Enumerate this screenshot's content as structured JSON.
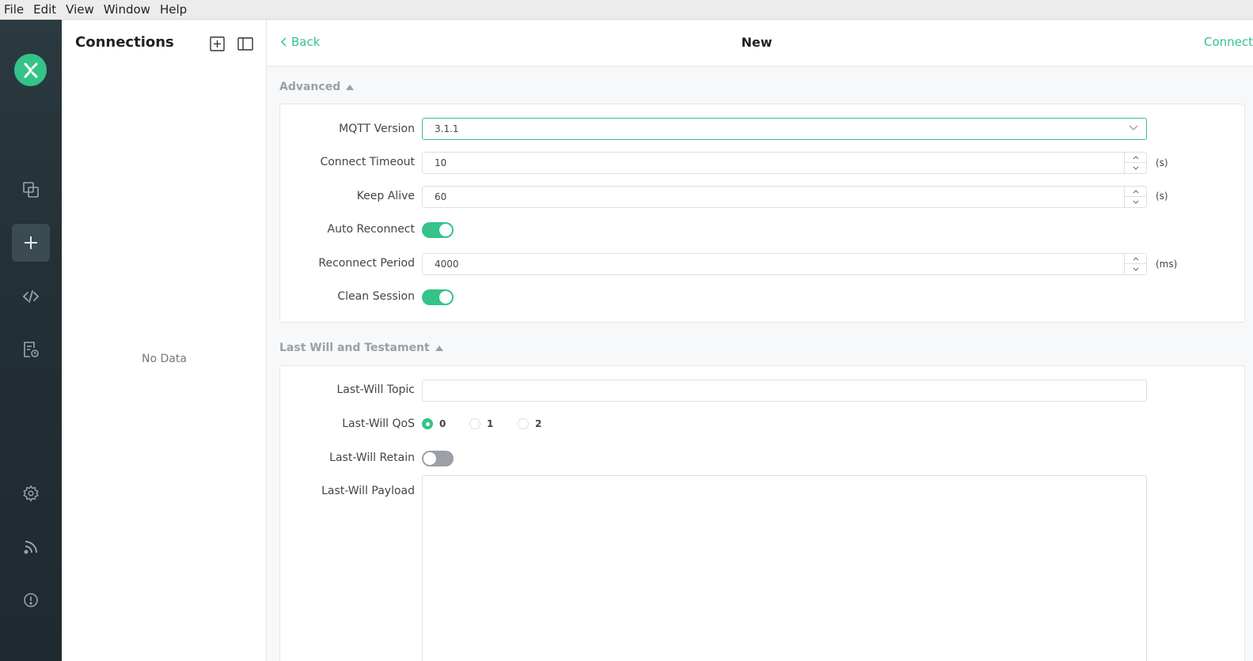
{
  "menubar": {
    "items": [
      "File",
      "Edit",
      "View",
      "Window",
      "Help"
    ]
  },
  "rail": {
    "logo": "mqttx-logo-icon",
    "items": [
      {
        "icon": "connections-icon",
        "active": false
      },
      {
        "icon": "plus-icon",
        "active": true
      },
      {
        "icon": "code-icon",
        "active": false
      },
      {
        "icon": "log-icon",
        "active": false
      },
      {
        "icon": "gear-icon",
        "active": false
      },
      {
        "icon": "feed-icon",
        "active": false
      },
      {
        "icon": "info-icon",
        "active": false
      }
    ]
  },
  "connections": {
    "title": "Connections",
    "empty_text": "No Data"
  },
  "topbar": {
    "back_label": "Back",
    "title": "New",
    "connect_label": "Connect"
  },
  "advanced": {
    "title": "Advanced",
    "mqtt_version": {
      "label": "MQTT Version",
      "value": "3.1.1"
    },
    "connect_timeout": {
      "label": "Connect Timeout",
      "value": "10",
      "unit": "(s)"
    },
    "keep_alive": {
      "label": "Keep Alive",
      "value": "60",
      "unit": "(s)"
    },
    "auto_reconnect": {
      "label": "Auto Reconnect",
      "on": true
    },
    "reconnect_period": {
      "label": "Reconnect Period",
      "value": "4000",
      "unit": "(ms)"
    },
    "clean_session": {
      "label": "Clean Session",
      "on": true
    }
  },
  "last_will": {
    "title": "Last Will and Testament",
    "topic": {
      "label": "Last-Will Topic",
      "value": ""
    },
    "qos": {
      "label": "Last-Will QoS",
      "options": [
        "0",
        "1",
        "2"
      ],
      "selected": "0"
    },
    "retain": {
      "label": "Last-Will Retain",
      "on": false
    },
    "payload": {
      "label": "Last-Will Payload",
      "value": ""
    }
  },
  "colors": {
    "accent": "#34c388",
    "rail_bg": "#233036"
  }
}
